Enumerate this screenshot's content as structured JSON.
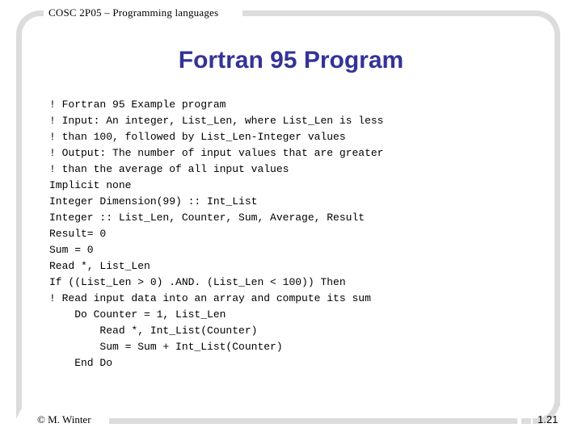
{
  "slide": {
    "header": "COSC 2P05 – Programming languages",
    "title": "Fortran 95 Program",
    "title_color": "#333399",
    "frame_color": "#dcdcdc",
    "code_lines": [
      "! Fortran 95 Example program",
      "! Input: An integer, List_Len, where List_Len is less",
      "! than 100, followed by List_Len-Integer values",
      "! Output: The number of input values that are greater",
      "! than the average of all input values",
      "Implicit none",
      "Integer Dimension(99) :: Int_List",
      "Integer :: List_Len, Counter, Sum, Average, Result",
      "Result= 0",
      "Sum = 0",
      "Read *, List_Len",
      "If ((List_Len > 0) .AND. (List_Len < 100)) Then",
      "! Read input data into an array and compute its sum",
      "    Do Counter = 1, List_Len",
      "        Read *, Int_List(Counter)",
      "        Sum = Sum + Int_List(Counter)",
      "    End Do"
    ],
    "footer": {
      "copyright": "© M. Winter",
      "page_number": "1.21"
    }
  }
}
